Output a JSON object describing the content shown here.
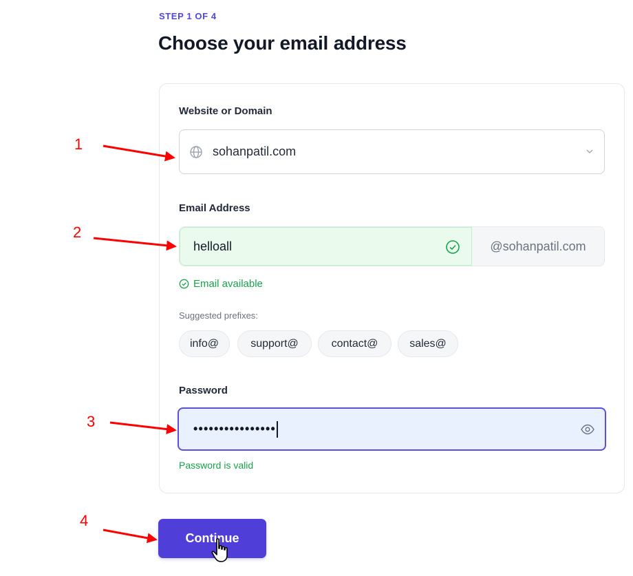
{
  "header": {
    "step": "STEP 1 OF 4",
    "title": "Choose your email address"
  },
  "domain": {
    "label": "Website or Domain",
    "value": "sohanpatil.com",
    "icon": "globe-icon",
    "dropdown_icon": "chevron-down-icon"
  },
  "email": {
    "label": "Email Address",
    "value": "helloall",
    "suffix": "@sohanpatil.com",
    "status_icon": "check-circle-icon",
    "availability": "Email available"
  },
  "suggestions": {
    "label": "Suggested prefixes:",
    "items": [
      "info@",
      "support@",
      "contact@",
      "sales@"
    ]
  },
  "password": {
    "label": "Password",
    "masked_value": "••••••••••••••••",
    "toggle_icon": "eye-icon",
    "validation": "Password is valid"
  },
  "actions": {
    "continue_label": "Continue"
  },
  "annotations": {
    "markers": [
      "1",
      "2",
      "3",
      "4"
    ],
    "color": "#ff0000"
  },
  "colors": {
    "accent": "#4f46e5",
    "success": "#16a34a",
    "button": "#4f3fd8"
  }
}
